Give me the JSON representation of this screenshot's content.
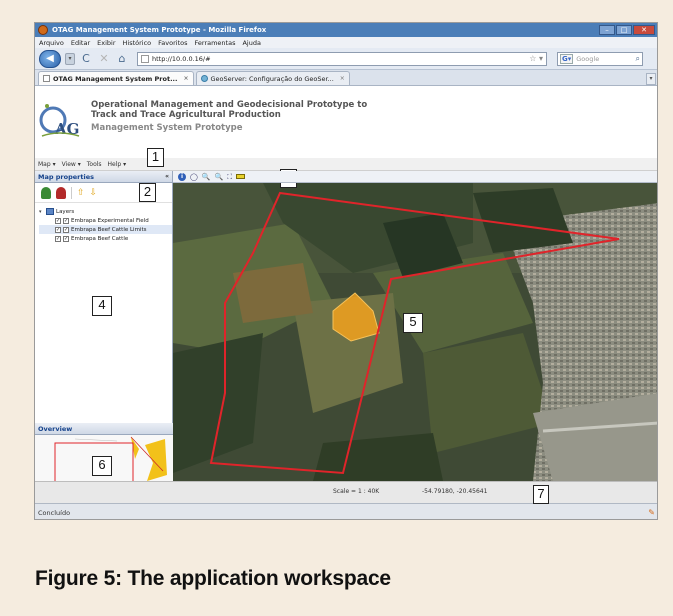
{
  "window": {
    "title": "OTAG Management System Prototype - Mozilla Firefox",
    "controls": [
      "–",
      "□",
      "✕"
    ]
  },
  "browser_menu": [
    "Arquivo",
    "Editar",
    "Exibir",
    "Histórico",
    "Favoritos",
    "Ferramentas",
    "Ajuda"
  ],
  "navbar": {
    "back_glyph": "◀",
    "fwd_glyph": "▾",
    "reload_glyph": "C",
    "stop_glyph": "✕",
    "home_glyph": "⌂",
    "url": "http://10.0.0.16/#",
    "star_glyph": "☆ ▾",
    "search_engine": "G▾",
    "search_placeholder": "Google",
    "search_glyph": "⌕"
  },
  "tabs": [
    {
      "label": "OTAG Management System Prot...",
      "close": "×",
      "active": true
    },
    {
      "label": "GeoServer: Configuração do GeoSer...",
      "close": "×",
      "active": false
    }
  ],
  "tabs_menu_glyph": "▾",
  "app": {
    "title_line1": "Operational Management and Geodecisional Prototype to",
    "title_line2": "Track and Trace Agricultural Production",
    "subtitle": "Management System Prototype"
  },
  "app_menu": [
    "Map ▾",
    "View ▾",
    "Tools",
    "Help ▾"
  ],
  "map_properties": {
    "title": "Map properties",
    "collapse": "«",
    "up_glyph": "⇧",
    "down_glyph": "⇩"
  },
  "layers": {
    "root": "Layers",
    "items": [
      {
        "label": "Embrapa Experimental Field",
        "checked": true,
        "selected": false
      },
      {
        "label": "Embrapa Beef Cattle Limits",
        "checked": true,
        "selected": true
      },
      {
        "label": "Embrapa Beef Cattle",
        "checked": true,
        "selected": false
      }
    ]
  },
  "overview_title": "Overview",
  "map_toolbar": [
    "i",
    "◯",
    "🔍",
    "🔍",
    "⛶",
    "▬"
  ],
  "status": {
    "scale": "Scale = 1 : 40K",
    "coords": "-54.79180, -20.45641"
  },
  "browser_status": "Concluído",
  "callouts": [
    "1",
    "2",
    "3",
    "4",
    "5",
    "6",
    "7"
  ],
  "caption": "Figure 5: The application workspace",
  "colors": {
    "titlebar": "#4b7eb8",
    "panel_header_text": "#15428b",
    "boundary": "#e0242a",
    "highlight_field": "#f2a11d",
    "page_bg": "#f5ecdf"
  }
}
